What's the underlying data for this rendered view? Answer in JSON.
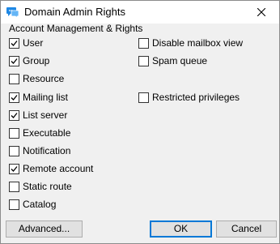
{
  "window": {
    "title": "Domain Admin Rights",
    "icon": "chat-bubbles-icon",
    "close_icon": "close-icon"
  },
  "group": {
    "label": "Account Management & Rights"
  },
  "checkboxes": {
    "user": {
      "label": "User",
      "checked": true
    },
    "group": {
      "label": "Group",
      "checked": true
    },
    "resource": {
      "label": "Resource",
      "checked": false
    },
    "mailing_list": {
      "label": "Mailing list",
      "checked": true
    },
    "list_server": {
      "label": "List server",
      "checked": true
    },
    "executable": {
      "label": "Executable",
      "checked": false
    },
    "notification": {
      "label": "Notification",
      "checked": false
    },
    "remote_account": {
      "label": "Remote account",
      "checked": true
    },
    "static_route": {
      "label": "Static route",
      "checked": false
    },
    "catalog": {
      "label": "Catalog",
      "checked": false
    },
    "disable_mailbox_view": {
      "label": "Disable mailbox view",
      "checked": false
    },
    "spam_queue": {
      "label": "Spam queue",
      "checked": false
    },
    "restricted_privileges": {
      "label": "Restricted privileges",
      "checked": false
    }
  },
  "buttons": {
    "advanced": "Advanced...",
    "ok": "OK",
    "cancel": "Cancel"
  },
  "colors": {
    "dialog_bg": "#f0f0f0",
    "title_bg": "#ffffff",
    "default_button_border": "#0078d7",
    "icon_blue": "#1e88e5"
  }
}
